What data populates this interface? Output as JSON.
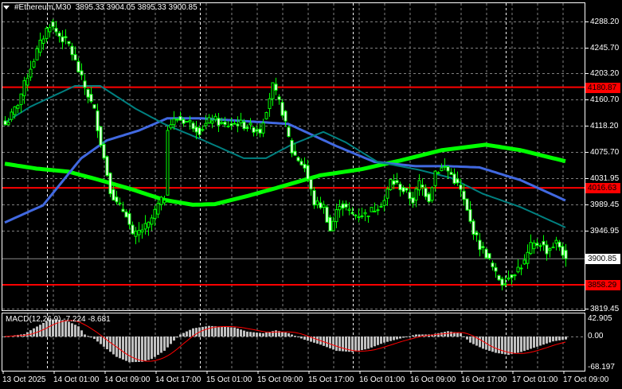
{
  "header": {
    "symbol": "#Ethereum,M30",
    "open": "3895.33",
    "high": "3904.05",
    "low": "3895.33",
    "close": "3900.85"
  },
  "colors": {
    "candle": "#00ff00",
    "ma_fast": "#008080",
    "ma_mid": "#4169e1",
    "ma_slow": "#00ff00",
    "level": "#ff0000",
    "macd_hist": "#c0c0c0",
    "macd_signal": "#ff0000",
    "grid": "#808080"
  },
  "chart_data": {
    "type": "candlestick",
    "timeframe": "M30",
    "price_axis": {
      "ticks": [
        "4288.20",
        "4245.70",
        "4203.20",
        "4160.70",
        "4118.20",
        "4075.70",
        "4031.95",
        "3989.45",
        "3946.95",
        "3819.45"
      ],
      "ylim": [
        3819.45,
        4288.2
      ]
    },
    "time_axis": {
      "ticks": [
        "13 Oct 2025",
        "14 Oct 01:00",
        "14 Oct 09:00",
        "14 Oct 17:00",
        "15 Oct 01:00",
        "15 Oct 09:00",
        "15 Oct 17:00",
        "16 Oct 01:00",
        "16 Oct 09:00",
        "16 Oct 17:00",
        "17 Oct 01:00",
        "17 Oct 09:00"
      ]
    },
    "current_price": "3900.85",
    "levels": [
      {
        "label": "4180.87",
        "price": 4180.87
      },
      {
        "label": "4016.63",
        "price": 4016.63
      },
      {
        "label": "3858.29",
        "price": 3858.29
      }
    ],
    "close_samples_bar_price": [
      [
        0,
        4120
      ],
      [
        2,
        4135
      ],
      [
        4,
        4155
      ],
      [
        7,
        4200
      ],
      [
        10,
        4240
      ],
      [
        13,
        4275
      ],
      [
        14,
        4284
      ],
      [
        17,
        4265
      ],
      [
        20,
        4250
      ],
      [
        24,
        4194
      ],
      [
        28,
        4142
      ],
      [
        30,
        4091
      ],
      [
        33,
        4014
      ],
      [
        35,
        3990
      ],
      [
        38,
        3975
      ],
      [
        40,
        3936
      ],
      [
        43,
        3949
      ],
      [
        45,
        3956
      ],
      [
        48,
        3988
      ],
      [
        50,
        4001
      ],
      [
        51,
        4117
      ],
      [
        54,
        4130
      ],
      [
        58,
        4123
      ],
      [
        61,
        4110
      ],
      [
        65,
        4130
      ],
      [
        69,
        4117
      ],
      [
        73,
        4123
      ],
      [
        76,
        4117
      ],
      [
        80,
        4110
      ],
      [
        84,
        4183
      ],
      [
        87,
        4141
      ],
      [
        90,
        4076
      ],
      [
        94,
        4050
      ],
      [
        97,
        3992
      ],
      [
        100,
        3986
      ],
      [
        102,
        3947
      ],
      [
        105,
        3992
      ],
      [
        109,
        3973
      ],
      [
        113,
        3973
      ],
      [
        116,
        3983
      ],
      [
        119,
        3996
      ],
      [
        121,
        4028
      ],
      [
        124,
        4018
      ],
      [
        128,
        3996
      ],
      [
        130,
        4025
      ],
      [
        133,
        3999
      ],
      [
        135,
        4044
      ],
      [
        138,
        4050
      ],
      [
        140,
        4038
      ],
      [
        143,
        4012
      ],
      [
        146,
        3960
      ],
      [
        149,
        3921
      ],
      [
        151,
        3908
      ],
      [
        154,
        3875
      ],
      [
        156,
        3862
      ],
      [
        159,
        3875
      ],
      [
        163,
        3895
      ],
      [
        165,
        3921
      ],
      [
        168,
        3927
      ],
      [
        170,
        3914
      ],
      [
        173,
        3927
      ],
      [
        174,
        3921
      ],
      [
        176,
        3900.85
      ]
    ],
    "ma_fast_bar_price": [
      [
        0,
        4123
      ],
      [
        8,
        4149
      ],
      [
        22,
        4183
      ],
      [
        30,
        4183
      ],
      [
        41,
        4146
      ],
      [
        50,
        4121
      ],
      [
        62,
        4095
      ],
      [
        75,
        4065
      ],
      [
        82,
        4065
      ],
      [
        90,
        4087
      ],
      [
        100,
        4108
      ],
      [
        107,
        4091
      ],
      [
        117,
        4059
      ],
      [
        130,
        4046
      ],
      [
        140,
        4033
      ],
      [
        150,
        4007
      ],
      [
        162,
        3985
      ],
      [
        176,
        3952
      ]
    ],
    "ma_mid_bar_price": [
      [
        0,
        3960
      ],
      [
        12,
        3988
      ],
      [
        24,
        4065
      ],
      [
        32,
        4094
      ],
      [
        42,
        4110
      ],
      [
        51,
        4130
      ],
      [
        62,
        4130
      ],
      [
        74,
        4126
      ],
      [
        89,
        4121
      ],
      [
        104,
        4085
      ],
      [
        116,
        4059
      ],
      [
        129,
        4052
      ],
      [
        139,
        4052
      ],
      [
        149,
        4050
      ],
      [
        162,
        4029
      ],
      [
        176,
        3996
      ]
    ],
    "ma_slow_bar_price": [
      [
        0,
        4056
      ],
      [
        10,
        4048
      ],
      [
        20,
        4043
      ],
      [
        30,
        4029
      ],
      [
        40,
        4014
      ],
      [
        50,
        3997
      ],
      [
        59,
        3989
      ],
      [
        66,
        3990
      ],
      [
        76,
        4003
      ],
      [
        85,
        4016
      ],
      [
        99,
        4037
      ],
      [
        112,
        4047
      ],
      [
        124,
        4061
      ],
      [
        137,
        4078
      ],
      [
        151,
        4087
      ],
      [
        162,
        4078
      ],
      [
        176,
        4060
      ]
    ],
    "macd": {
      "label": "MACD(12,26,9) -7.224 -8.681",
      "ticks": [
        "42.905",
        "0.00",
        "-68.197"
      ],
      "ylim": [
        -68.197,
        42.905
      ],
      "main": -7.224,
      "signal": -8.681,
      "hist_bar_value": [
        [
          0,
          0
        ],
        [
          6,
          6
        ],
        [
          9,
          20
        ],
        [
          14,
          42
        ],
        [
          19,
          40
        ],
        [
          23,
          25
        ],
        [
          25,
          5
        ],
        [
          28,
          -6
        ],
        [
          31,
          -25
        ],
        [
          35,
          -50
        ],
        [
          39,
          -63
        ],
        [
          43,
          -62
        ],
        [
          46,
          -55
        ],
        [
          50,
          -35
        ],
        [
          53,
          -10
        ],
        [
          55,
          5
        ],
        [
          59,
          20
        ],
        [
          64,
          26
        ],
        [
          72,
          22
        ],
        [
          76,
          12
        ],
        [
          81,
          8
        ],
        [
          85,
          15
        ],
        [
          89,
          8
        ],
        [
          94,
          -8
        ],
        [
          99,
          -20
        ],
        [
          104,
          -35
        ],
        [
          109,
          -38
        ],
        [
          114,
          -30
        ],
        [
          119,
          -15
        ],
        [
          124,
          -5
        ],
        [
          129,
          5
        ],
        [
          134,
          5
        ],
        [
          139,
          13
        ],
        [
          143,
          8
        ],
        [
          146,
          -15
        ],
        [
          150,
          -30
        ],
        [
          154,
          -40
        ],
        [
          158,
          -45
        ],
        [
          162,
          -38
        ],
        [
          167,
          -25
        ],
        [
          172,
          -12
        ],
        [
          176,
          -7.224
        ]
      ]
    }
  }
}
